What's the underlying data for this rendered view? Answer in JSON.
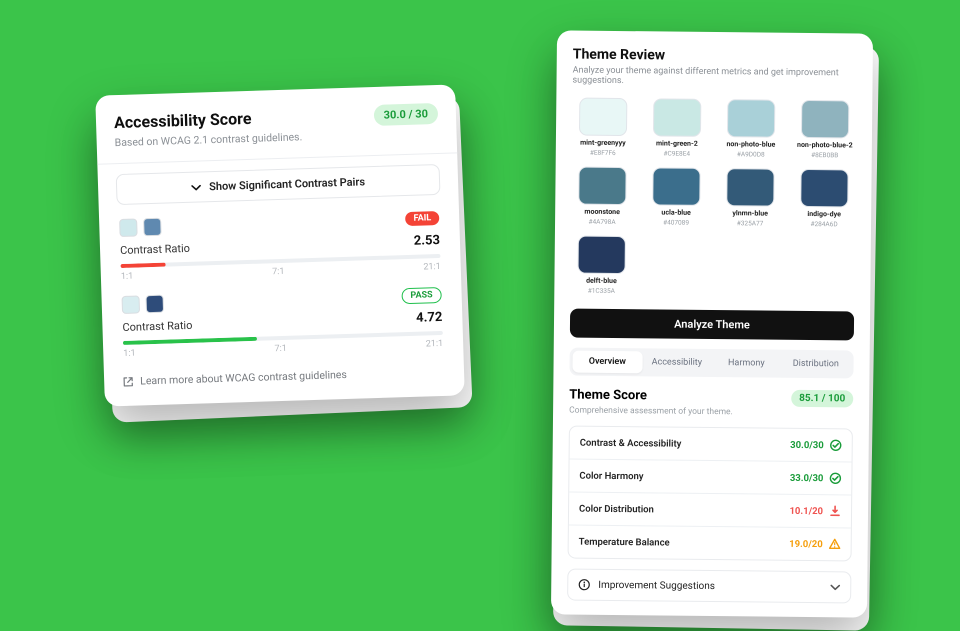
{
  "left": {
    "title": "Accessibility Score",
    "subtitle": "Based on WCAG 2.1 contrast guidelines.",
    "score_text": "30.0 / 30",
    "toggle_label": "Show Significant Contrast Pairs",
    "scale": {
      "low": "1:1",
      "mid": "7:1",
      "high": "21:1"
    },
    "pair1": {
      "swatch_a": "#cfe9ec",
      "swatch_b": "#5f89b0",
      "badge": "FAIL",
      "label": "Contrast Ratio",
      "value": "2.53",
      "fill_pct": 14,
      "fill_color": "#f44336"
    },
    "pair2": {
      "swatch_a": "#d8edf0",
      "swatch_b": "#2e4c7a",
      "badge": "PASS",
      "label": "Contrast Ratio",
      "value": "4.72",
      "fill_pct": 42,
      "fill_color": "#29c24a"
    },
    "learn_more": "Learn more about WCAG contrast guidelines"
  },
  "right": {
    "title": "Theme Review",
    "subtitle": "Analyze your theme against different metrics and get improvement suggestions.",
    "palette": [
      {
        "name": "mint-greenyyy",
        "hex": "#E8F7F6",
        "color": "#E8F7F6"
      },
      {
        "name": "mint-green-2",
        "hex": "#C9E8E4",
        "color": "#C9E8E4"
      },
      {
        "name": "non-photo-blue",
        "hex": "#A9D0D8",
        "color": "#A9D0D8"
      },
      {
        "name": "non-photo-blue-2",
        "hex": "#8EB0BB",
        "color": "#8FB3BE"
      },
      {
        "name": "moonstone",
        "hex": "#4A798A",
        "color": "#4A798A"
      },
      {
        "name": "ucla-blue",
        "hex": "#407089",
        "color": "#3B6E8C"
      },
      {
        "name": "ylnmn-blue",
        "hex": "#325A77",
        "color": "#335A78"
      },
      {
        "name": "indigo-dye",
        "hex": "#284A6D",
        "color": "#2C4C71"
      },
      {
        "name": "delft-blue",
        "hex": "#1C335A",
        "color": "#24395E"
      }
    ],
    "analyze_label": "Analyze Theme",
    "tabs": [
      "Overview",
      "Accessibility",
      "Harmony",
      "Distribution"
    ],
    "active_tab": 0,
    "theme_score": {
      "title": "Theme Score",
      "subtitle": "Comprehensive assessment of your theme.",
      "badge": "85.1 / 100"
    },
    "metrics": [
      {
        "label": "Contrast & Accessibility",
        "value": "30.0/30",
        "tone": "good"
      },
      {
        "label": "Color Harmony",
        "value": "33.0/30",
        "tone": "good"
      },
      {
        "label": "Color Distribution",
        "value": "10.1/20",
        "tone": "bad"
      },
      {
        "label": "Temperature Balance",
        "value": "19.0/20",
        "tone": "warn"
      }
    ],
    "suggestions_label": "Improvement Suggestions"
  }
}
